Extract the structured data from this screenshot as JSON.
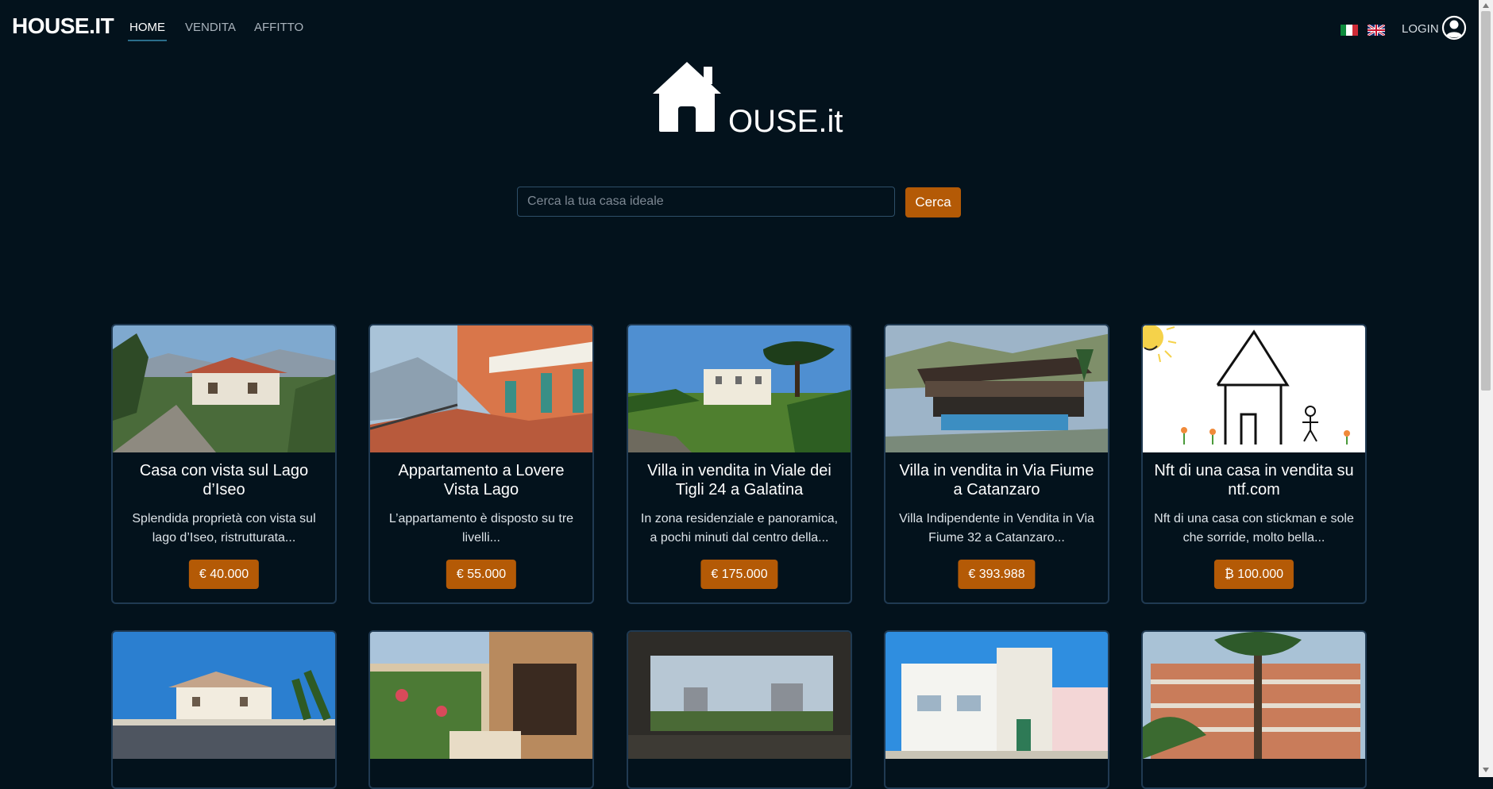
{
  "nav": {
    "brand": "HOUSE.IT",
    "links": [
      {
        "label": "HOME",
        "active": true
      },
      {
        "label": "VENDITA",
        "active": false
      },
      {
        "label": "AFFITTO",
        "active": false
      }
    ],
    "login_label": "LOGIN",
    "flags": [
      "italian-flag-icon",
      "uk-flag-icon"
    ]
  },
  "hero": {
    "logo_icon": "house-icon",
    "title": "OUSE.it"
  },
  "search": {
    "placeholder": "Cerca la tua casa ideale",
    "value": "",
    "button_label": "Cerca"
  },
  "colors": {
    "background": "#03121c",
    "accent": "#b45a06",
    "card_border": "#203a52"
  },
  "listings": [
    {
      "title": "Casa con vista sul Lago d’Iseo",
      "description": "Splendida proprietà con vista sul lago d’Iseo, ristrutturata...",
      "price": "€ 40.000"
    },
    {
      "title": "Appartamento a Lovere Vista Lago",
      "description": "L’appartamento è disposto su tre livelli...",
      "price": "€ 55.000"
    },
    {
      "title": "Villa in vendita in Viale dei Tigli 24 a Galatina",
      "description": "In zona residenziale e panoramica, a pochi minuti dal centro della...",
      "price": "€ 175.000"
    },
    {
      "title": "Villa in vendita in Via Fiume a Catanzaro",
      "description": "Villa Indipendente in Vendita in Via Fiume 32 a Catanzaro...",
      "price": "€ 393.988"
    },
    {
      "title": "Nft di una casa in vendita su ntf.com",
      "description": "Nft di una casa con stickman e sole che sorride, molto bella...",
      "price": "₿ 100.000"
    }
  ]
}
